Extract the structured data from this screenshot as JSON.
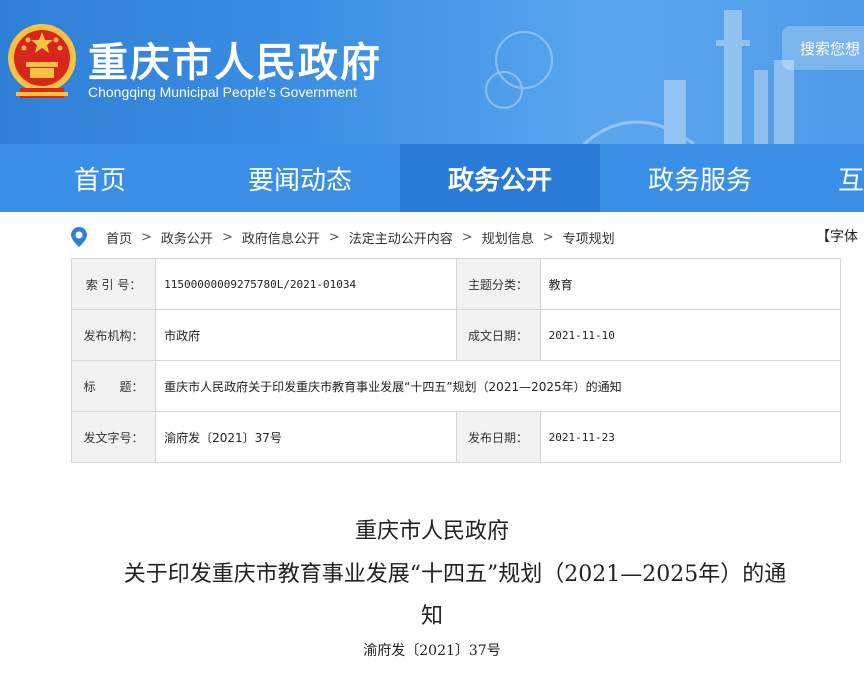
{
  "header": {
    "title": "重庆市人民政府",
    "subtitle": "Chongqing Municipal People's Government",
    "search_label": "搜索您想"
  },
  "nav": {
    "items": [
      {
        "label": "首页",
        "active": false
      },
      {
        "label": "要闻动态",
        "active": false
      },
      {
        "label": "政务公开",
        "active": true
      },
      {
        "label": "政务服务",
        "active": false
      },
      {
        "label": "互",
        "active": false
      }
    ]
  },
  "breadcrumb": {
    "items": [
      "首页",
      "政务公开",
      "政府信息公开",
      "法定主动公开内容",
      "规划信息",
      "专项规划"
    ],
    "separator": ">",
    "font_size_label": "【字体"
  },
  "info": {
    "index_label": "索 引 号：",
    "index_value": "11500000009275780L/2021-01034",
    "topic_label": "主题分类：",
    "topic_value": "教育",
    "org_label": "发布机构：",
    "org_value": "市政府",
    "created_label": "成文日期：",
    "created_value": "2021-11-10",
    "title_label": "标　　题：",
    "title_value": "重庆市人民政府关于印发重庆市教育事业发展“十四五”规划（2021—2025年）的通知",
    "docno_label": "发文字号：",
    "docno_value": "渝府发〔2021〕37号",
    "published_label": "发布日期：",
    "published_value": "2021-11-23"
  },
  "document": {
    "line1": "重庆市人民政府",
    "line2": "关于印发重庆市教育事业发展“十四五”规划（2021—2025年）的通",
    "line3": "知",
    "doc_number": "渝府发〔2021〕37号"
  },
  "colors": {
    "banner": "#3b8ee3",
    "nav": "#3a8fe6",
    "nav_active": "#2a7ad8",
    "emblem_red": "#d8261c",
    "emblem_gold": "#f5c242"
  }
}
